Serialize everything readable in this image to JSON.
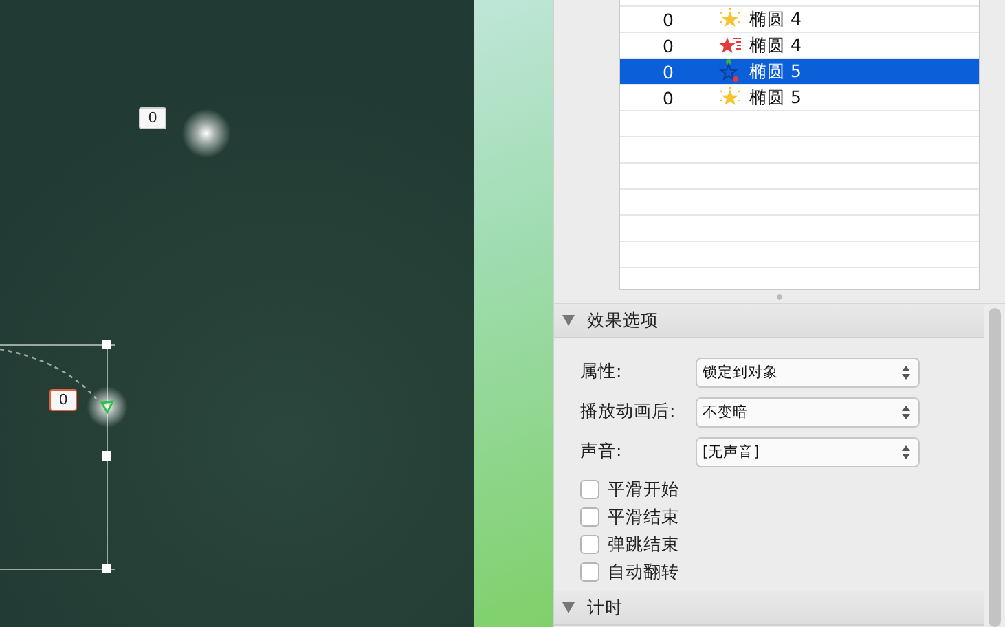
{
  "canvas": {
    "tags": [
      {
        "label": "0",
        "selected": false
      },
      {
        "label": "0",
        "selected": true
      }
    ]
  },
  "animation_list": {
    "rows": [
      {
        "order": "0",
        "kind": "emphasis",
        "name": "椭圆 4",
        "selected": false
      },
      {
        "order": "0",
        "kind": "exit",
        "name": "椭圆 4",
        "selected": false
      },
      {
        "order": "0",
        "kind": "motion",
        "name": "椭圆 5",
        "selected": true
      },
      {
        "order": "0",
        "kind": "emphasis",
        "name": "椭圆 5",
        "selected": false
      }
    ]
  },
  "effect_options": {
    "title": "效果选项",
    "expanded": true,
    "fields": [
      {
        "label": "属性:",
        "value": "锁定到对象"
      },
      {
        "label": "播放动画后:",
        "value": "不变暗"
      },
      {
        "label": "声音:",
        "value": "[无声音]"
      }
    ],
    "checkboxes": [
      {
        "label": "平滑开始",
        "checked": false
      },
      {
        "label": "平滑结束",
        "checked": false
      },
      {
        "label": "弹跳结束",
        "checked": false
      },
      {
        "label": "自动翻转",
        "checked": false
      }
    ]
  },
  "timing": {
    "title": "计时",
    "expanded": true
  }
}
